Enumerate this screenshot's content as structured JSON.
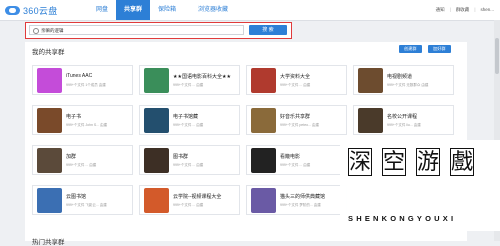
{
  "app": {
    "logo_text": "360云盘"
  },
  "nav": {
    "items": [
      {
        "label": "网盘"
      },
      {
        "label": "共享群"
      },
      {
        "label": "保险箱"
      },
      {
        "label": "浏览器收藏"
      }
    ]
  },
  "header_right": {
    "notice": "通知",
    "group_chat": "群收藏",
    "user": "shen..."
  },
  "search": {
    "value": "亲嘛的逻辑",
    "button_label": "搜 索"
  },
  "my_groups": {
    "title": "我的共享群",
    "create_label": "创建群",
    "join_label": "加好群",
    "cards": [
      {
        "title": "iTunes AAC",
        "meta": "999+个文件  1个成员  由建",
        "icon": "music-app-icon",
        "color": "#c44cd9"
      },
      {
        "title": "★★国语电影百科大全★★",
        "meta": "999+个文件  ...  由建",
        "icon": "film-reel-icon",
        "color": "#3a8e5a"
      },
      {
        "title": "大学资料大全",
        "meta": "999+个文件  ...  由建",
        "icon": "temple-icon",
        "color": "#b03a2e"
      },
      {
        "title": "电视剧频道",
        "meta": "999+个文件  无数群众  由建",
        "icon": "tv-icon",
        "color": "#6d4c2f"
      },
      {
        "title": "电子书",
        "meta": "999+个文件  John S...  由建",
        "icon": "bookshelf-icon",
        "color": "#7a4a2a"
      },
      {
        "title": "电子书馆藏",
        "meta": "999+个文件  ...  由建",
        "icon": "library-icon",
        "color": "#234f6e"
      },
      {
        "title": "好音乐共享群",
        "meta": "999+个文件  peteo...  由建",
        "icon": "piano-icon",
        "color": "#8a6a3a"
      },
      {
        "title": "名校公开课程",
        "meta": "999+个文件  liu...  由建",
        "icon": "campus-icon",
        "color": "#4a3a2a"
      },
      {
        "title": "加群",
        "meta": "999+个文件  ...  由建",
        "icon": "people-icon",
        "color": "#5b4a3a"
      },
      {
        "title": "图书群",
        "meta": "999+个文件  ...  由建",
        "icon": "book-stack-icon",
        "color": "#3d2f25"
      },
      {
        "title": "看簸电影",
        "meta": "999+个文件  ...  由建",
        "icon": "cinema-icon",
        "color": "#222"
      },
      {
        "title": "",
        "meta": "",
        "icon": "",
        "color": "#ffffff"
      },
      {
        "title": "云图书馆",
        "meta": "999+个文件  飞影云...  由建",
        "icon": "city-icon",
        "color": "#3b6fb3"
      },
      {
        "title": "云学院--视频课程大全",
        "meta": "999+个文件  ...  由建",
        "icon": "ink-logo-icon",
        "color": "#d35a2a"
      },
      {
        "title": "猫头三的师供典藏馆",
        "meta": "999+个文件  梦阶的...  由建",
        "icon": "owl-icon",
        "color": "#6a5aa5"
      },
      {
        "title": "",
        "meta": "",
        "icon": "",
        "color": "#ffffff"
      }
    ]
  },
  "hot_groups": {
    "title": "热门共享群"
  },
  "watermark": {
    "chars": [
      "深",
      "空",
      "游",
      "戲"
    ],
    "subtitle": "SHENKONGYOUXI"
  }
}
